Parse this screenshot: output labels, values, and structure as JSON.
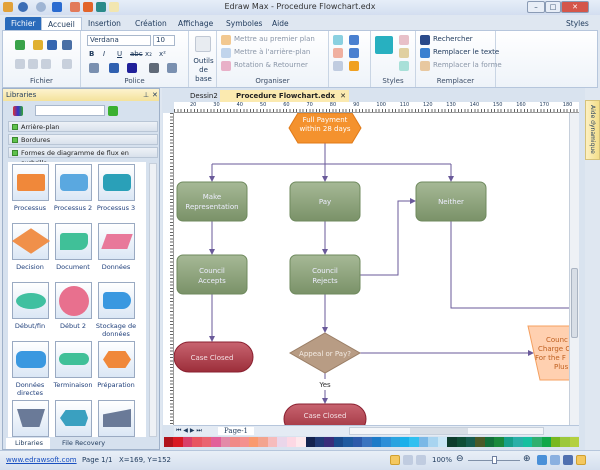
{
  "window": {
    "title": "Edraw Max - Procedure Flowchart.edx"
  },
  "tabs": [
    "Fichier",
    "Accueil",
    "Insertion",
    "Création",
    "Affichage",
    "Symboles",
    "Aide"
  ],
  "styles_label": "Styles",
  "ribbon": {
    "fichier": {
      "label": "Fichier"
    },
    "police": {
      "label": "Police",
      "font": "Verdana",
      "size": "10",
      "bold": "B",
      "italic": "I",
      "underline": "U",
      "strike": "abc",
      "sub": "x₂",
      "sup": "x²"
    },
    "outils": {
      "label": "Outils de base"
    },
    "organiser": {
      "label": "Organiser",
      "front": "Mettre au premier plan",
      "back": "Mettre à l'arrière-plan",
      "rotate": "Rotation & Retourner"
    },
    "styles": {
      "label": "Styles"
    },
    "remplacer": {
      "label": "Remplacer",
      "find": "Rechercher",
      "replace_text": "Remplacer le texte",
      "replace_shape": "Remplacer la forme"
    }
  },
  "libraries": {
    "title": "Libraries",
    "categories": [
      "Arrière-plan",
      "Bordures",
      "Formes de diagramme de flux en surbrilla..."
    ],
    "shapes": [
      "Processus",
      "Processus 2",
      "Processus 3",
      "Decision",
      "Document",
      "Données",
      "Début/fin",
      "Début 2",
      "Stockage de données",
      "Données directes",
      "Terminaison",
      "Préparation"
    ],
    "bottom_tabs": [
      "Libraries",
      "File Recovery"
    ]
  },
  "document": {
    "tabs": [
      "Dessin2",
      "Procedure Flowchart.edx"
    ],
    "page_tab": "Page-1",
    "aide": "Aide dynamique",
    "ruler_top": [
      "20",
      "30",
      "40",
      "50",
      "60",
      "70",
      "80",
      "90",
      "100",
      "110",
      "120",
      "130",
      "140",
      "150",
      "160",
      "170",
      "180"
    ],
    "flow": {
      "start": [
        "Full Payment",
        "within 28 days"
      ],
      "make_rep": [
        "Make",
        "Representation"
      ],
      "pay": "Pay",
      "neither": "Neither",
      "accepts": [
        "Council",
        "Accepts"
      ],
      "rejects": [
        "Council",
        "Rejects"
      ],
      "case_closed": "Case Closed",
      "appeal": "Appeal or Pay?",
      "yes": "Yes",
      "case_closed2": "Case Closed",
      "charge": [
        "Counc",
        "Charge C",
        "For the F",
        "Plus"
      ]
    }
  },
  "palette": [
    "#b0141c",
    "#d91a23",
    "#d9406a",
    "#e85560",
    "#ea6470",
    "#e2609a",
    "#e38aa8",
    "#f08a86",
    "#f4908e",
    "#f99a6e",
    "#f3a48e",
    "#f6bcbc",
    "#ead6ea",
    "#fcd8e4",
    "#fde8ec",
    "#14234f",
    "#213a76",
    "#3a2d7a",
    "#1a4a8c",
    "#1f5aa0",
    "#2d5aaa",
    "#3a74c0",
    "#1d7bc8",
    "#2d8fd8",
    "#29a3e0",
    "#1ab0ea",
    "#30c0f0",
    "#7ab8e6",
    "#a8d4f0",
    "#c9e6f6",
    "#0d3c2c",
    "#0f4e36",
    "#165c4e",
    "#4a5a28",
    "#12703a",
    "#1a8a3c",
    "#17a08a",
    "#2ab0a8",
    "#17c0a0",
    "#30b070",
    "#12a84a",
    "#78b820",
    "#9cc83c",
    "#b4d040"
  ],
  "status": {
    "link": "www.edrawsoft.com",
    "page": "Page 1/1",
    "coords": "X=169, Y=152",
    "zoom": "100%"
  }
}
